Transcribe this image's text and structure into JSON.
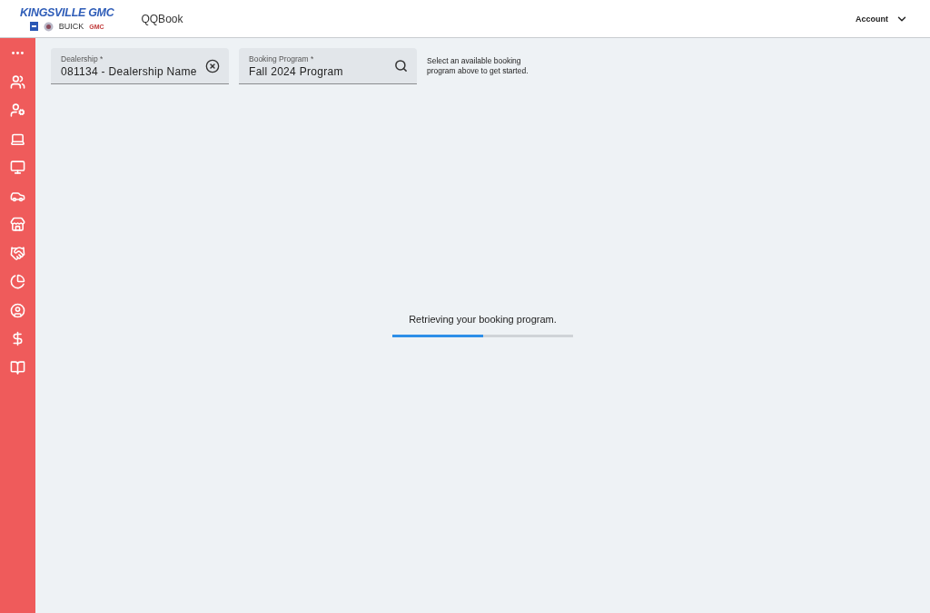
{
  "header": {
    "dealer_name": "KINGSVILLE GMC",
    "brands": [
      "BUICK",
      "GMC"
    ],
    "app_name": "QQBook",
    "account": "Account"
  },
  "fields": [
    {
      "label": "Dealership *",
      "value": "081134 - Dealership Name",
      "kind": "clear"
    },
    {
      "label": "Booking Program *",
      "value": "Fall 2024 Program",
      "kind": "search"
    }
  ],
  "hint": "Select an available booking program above to get started.",
  "loading": {
    "message": "Retrieving your booking program.",
    "level": 0.5
  }
}
